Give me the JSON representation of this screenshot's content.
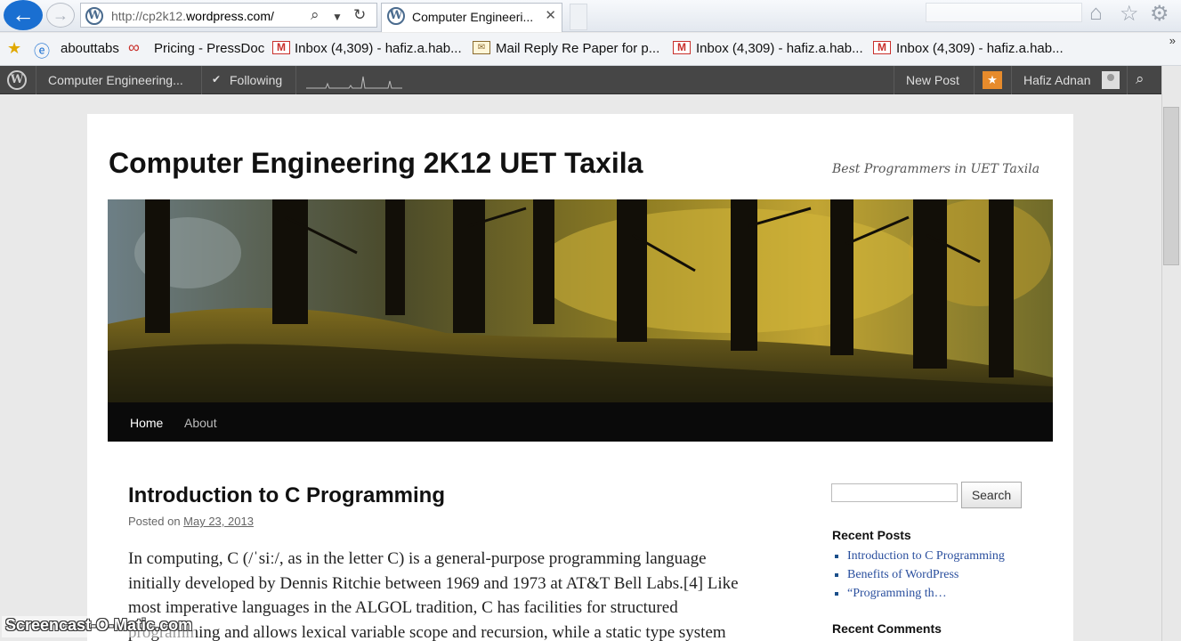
{
  "browser": {
    "url_prefix": "http://cp2k12.",
    "url_domain": "wordpress.com/",
    "tab_title": "Computer Engineeri...",
    "tab_close": "✕"
  },
  "favorites": [
    {
      "label": "abouttabs"
    },
    {
      "label": "Pricing - PressDoc"
    },
    {
      "label": "Inbox (4,309) - hafiz.a.hab..."
    },
    {
      "label": "Mail  Reply Re Paper for p..."
    },
    {
      "label": "Inbox (4,309) - hafiz.a.hab..."
    },
    {
      "label": "Inbox (4,309) - hafiz.a.hab..."
    }
  ],
  "adminbar": {
    "site_name": "Computer Engineering...",
    "following": "Following",
    "new_post": "New Post",
    "user": "Hafiz Adnan"
  },
  "site": {
    "title": "Computer Engineering 2K12 UET Taxila",
    "description": "Best Programmers in UET Taxila"
  },
  "nav": {
    "home": "Home",
    "about": "About"
  },
  "post": {
    "title": "Introduction to C Programming",
    "posted_on": "Posted on ",
    "date": "May 23, 2013",
    "body": "In computing, C (/ˈsiː/, as in the letter C) is a general-purpose programming language initially developed by Dennis Ritchie between 1969 and 1973 at AT&T Bell Labs.[4] Like most imperative languages in the ALGOL tradition, C has facilities for structured programming and allows lexical variable scope and recursion, while a static type system"
  },
  "sidebar": {
    "search_button": "Search",
    "recent_posts_title": "Recent Posts",
    "recent_posts": [
      "Introduction to C Programming",
      "Benefits of WordPress",
      "“Programming th…"
    ],
    "recent_comments_title": "Recent Comments"
  },
  "watermark": "Screencast-O-Matic.com",
  "colors": {
    "admin_bar": "#464646",
    "nav_bar": "#0a0a0a",
    "link": "#2a4f9e",
    "accent_star": "#e78b2c"
  }
}
